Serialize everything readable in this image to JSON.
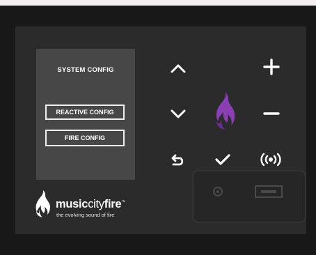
{
  "screen": {
    "title": "SYSTEM CONFIG",
    "menu": [
      {
        "label": "REACTIVE CONFIG"
      },
      {
        "label": "FIRE CONFIG"
      }
    ]
  },
  "brand": {
    "name_bold_1": "music",
    "name_light": "city",
    "name_bold_2": "fire",
    "trademark": "™",
    "tagline": "the evolving sound of fire"
  },
  "controls": [
    {
      "icon": "chevron-up-icon"
    },
    {
      "icon": "plus-icon"
    },
    {
      "icon": "chevron-down-icon"
    },
    {
      "icon": "minus-icon"
    },
    {
      "icon": "back-arrow-icon"
    },
    {
      "icon": "checkmark-icon"
    },
    {
      "icon": "broadcast-icon"
    }
  ],
  "colors": {
    "device": "#181818",
    "faceplate": "#2b2b2b",
    "screen": "#474747",
    "flame_accent": "#8a3fb5"
  }
}
